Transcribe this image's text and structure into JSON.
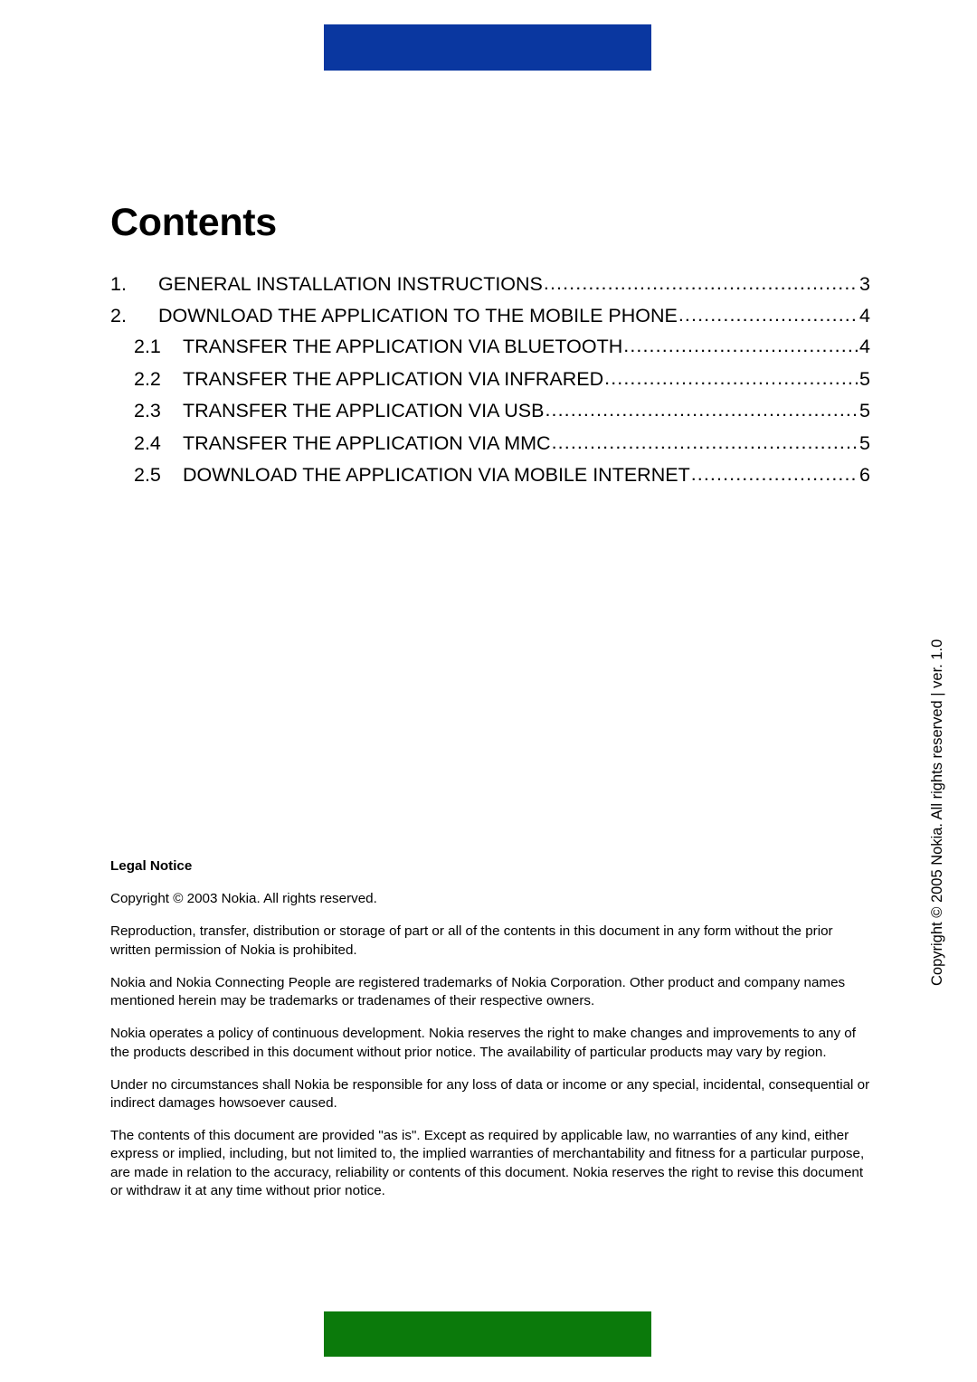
{
  "decor": {
    "top_bar_color": "#0a37a0",
    "bottom_bar_color": "#0b7a0b"
  },
  "title": "Contents",
  "toc": {
    "entries": [
      {
        "number": "1.",
        "label": "GENERAL INSTALLATION INSTRUCTIONS",
        "page": "3",
        "level": 1
      },
      {
        "number": "2.",
        "label": "DOWNLOAD THE APPLICATION TO THE MOBILE PHONE",
        "page": "4",
        "level": 1
      },
      {
        "number": "2.1",
        "label": "TRANSFER THE APPLICATION VIA BLUETOOTH",
        "page": "4",
        "level": 2
      },
      {
        "number": "2.2",
        "label": "TRANSFER THE APPLICATION VIA INFRARED",
        "page": "5",
        "level": 2
      },
      {
        "number": "2.3",
        "label": "TRANSFER THE APPLICATION VIA USB",
        "page": "5",
        "level": 2
      },
      {
        "number": "2.4",
        "label": "TRANSFER THE APPLICATION VIA MMC",
        "page": "5",
        "level": 2
      },
      {
        "number": "2.5",
        "label": "DOWNLOAD THE APPLICATION VIA MOBILE INTERNET",
        "page": "6",
        "level": 2
      }
    ]
  },
  "legal": {
    "heading": "Legal Notice",
    "paragraphs": [
      "Copyright © 2003 Nokia. All rights reserved.",
      "Reproduction, transfer, distribution or storage of part or all of the contents in this document in any form without the prior written permission of Nokia is prohibited.",
      "Nokia and Nokia Connecting People are registered trademarks of Nokia Corporation. Other product and company names mentioned herein may be trademarks or tradenames of their respective owners.",
      "Nokia operates a policy of continuous development. Nokia reserves the right to make changes and improvements to any of the products described in this document without prior notice. The availability of particular products may vary by region.",
      "Under no circumstances shall Nokia be responsible for any loss of data or income or any special, incidental, consequential or indirect damages howsoever caused.",
      "The contents of this document are provided \"as is\". Except as required by applicable law, no warranties of any kind, either express or implied, including, but not limited to, the implied warranties of merchantability and fitness for a particular purpose, are made in relation to the accuracy, reliability or contents of this document. Nokia reserves the right to revise this document or withdraw it at any time without prior notice."
    ]
  },
  "side_copyright": "Copyright © 2005 Nokia. All rights reserved | ver. 1.0"
}
